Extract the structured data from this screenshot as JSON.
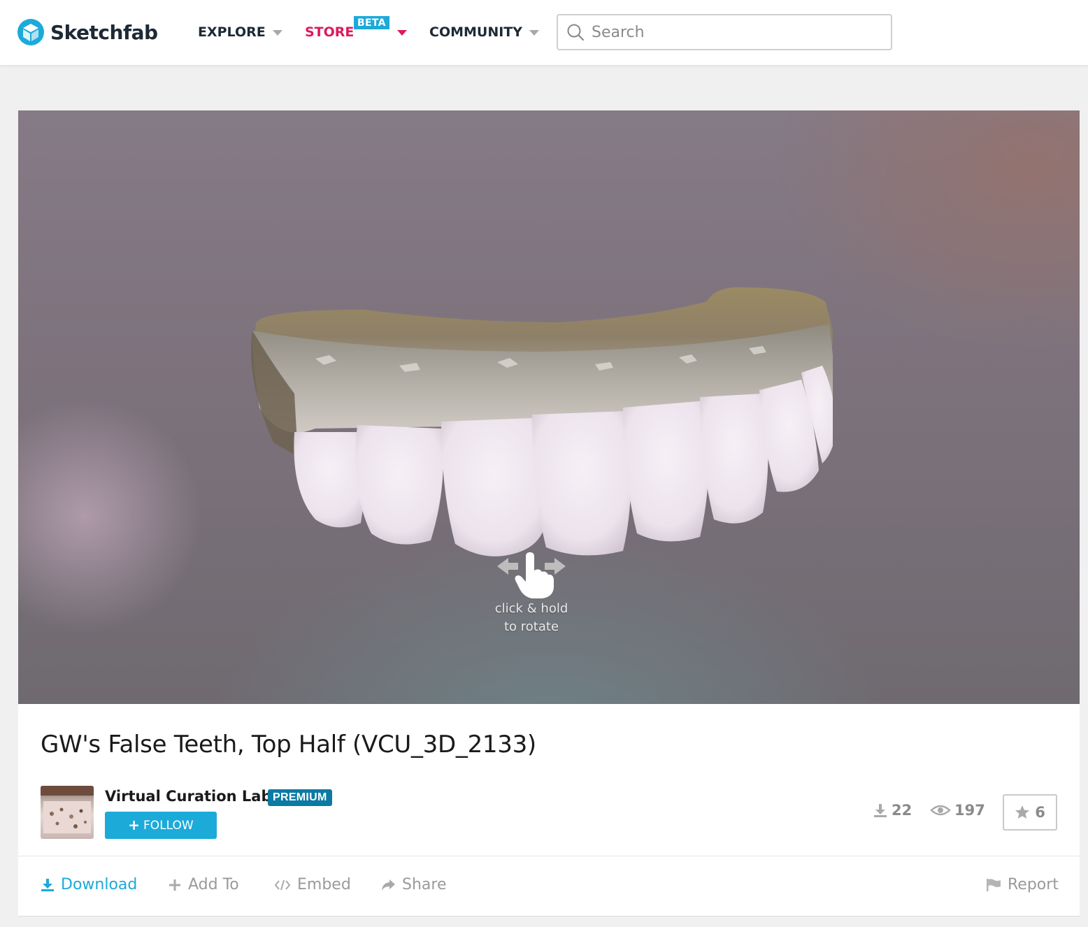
{
  "header": {
    "logo_text": "Sketchfab",
    "nav": {
      "explore": "EXPLORE",
      "store": "STORE",
      "store_badge": "BETA",
      "community": "COMMUNITY"
    },
    "search": {
      "placeholder": "Search",
      "value": ""
    }
  },
  "viewer": {
    "hint_line1": "click & hold",
    "hint_line2": "to rotate"
  },
  "model": {
    "title": "GW's False Teeth, Top Half (VCU_3D_2133)",
    "author": {
      "name": "Virtual Curation Lab",
      "badge": "PREMIUM",
      "follow_label": "FOLLOW"
    },
    "stats": {
      "downloads": "22",
      "views": "197",
      "likes": "6"
    },
    "actions": {
      "download": "Download",
      "add_to": "Add To",
      "embed": "Embed",
      "share": "Share",
      "report": "Report"
    }
  },
  "colors": {
    "brand_blue": "#1caad9",
    "store_pink": "#dd1a5a",
    "premium_blue": "#0c7aa3",
    "text_dark": "#1d2935",
    "muted": "#9a9a9a"
  }
}
